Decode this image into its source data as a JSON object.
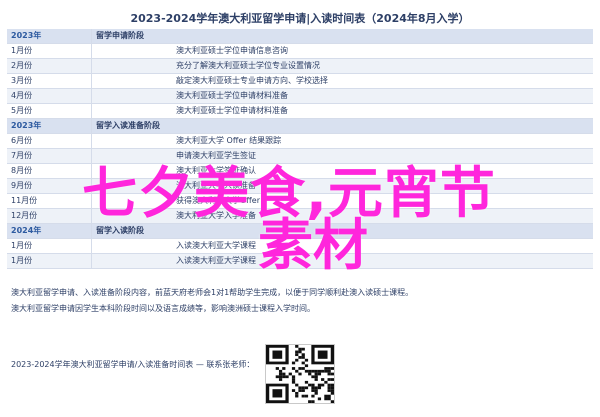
{
  "document": {
    "title": "2023-2024学年澳大利亚留学申请|入读时间表（2024年8月入学）",
    "rows": [
      {
        "type": "section",
        "date": "2023年",
        "event": "留学申请阶段"
      },
      {
        "type": "row",
        "date": "1月份",
        "event": "澳大利亚硕士学位申请信息咨询"
      },
      {
        "type": "row",
        "date": "2月份",
        "event": "充分了解澳大利亚硕士学位专业设置情况"
      },
      {
        "type": "row",
        "date": "3月份",
        "event": "敲定澳大利亚硕士专业申请方向、学校选择"
      },
      {
        "type": "row",
        "date": "4月份",
        "event": "澳大利亚硕士学位申请材料准备"
      },
      {
        "type": "row",
        "date": "5月份",
        "event": "澳大利亚硕士学位申请材料准备"
      },
      {
        "type": "section",
        "date": "2023年",
        "event": "留学入读准备阶段"
      },
      {
        "type": "row",
        "date": "6月份",
        "event": "澳大利亚大学 Offer 结果跟踪"
      },
      {
        "type": "row",
        "date": "7月份",
        "event": "申请澳大利亚学生签证"
      },
      {
        "type": "row",
        "date": "8月份",
        "event": "澳大利亚大学签证确认"
      },
      {
        "type": "row",
        "date": "9月份",
        "event": "澳大利亚大学入读准备"
      },
      {
        "type": "row",
        "date": "11月份",
        "event": "获得澳大利亚大学Offer"
      },
      {
        "type": "row",
        "date": "12月份",
        "event": "澳大利亚大学入学准备"
      },
      {
        "type": "section",
        "date": "2024年",
        "event": "留学入读阶段"
      },
      {
        "type": "row",
        "date": "1月份",
        "event": "入读澳大利亚大学课程"
      },
      {
        "type": "row",
        "date": "1月份",
        "event": "入读澳大利亚大学课程"
      }
    ],
    "notes": [
      "澳大利亚留学申请、入读准备阶段内容，前蓝天府老师会1对1帮助学生完成，以便于同学顺利赴澳入读硕士课程。",
      "澳大利亚留学申请因学生本科阶段时间以及语言成绩等，影响澳洲硕士课程入学时间。"
    ],
    "footer": "2023-2024学年澳大利亚留学申请/入读准备时间表 — 联系张老师：",
    "overlay_line1": "七夕美食,元宵节",
    "overlay_line2": "素材"
  }
}
